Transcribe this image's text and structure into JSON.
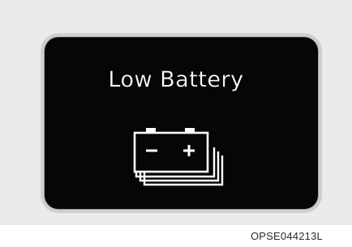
{
  "display": {
    "message": "Low Battery",
    "icon": "battery-warning-icon",
    "background_color": "#060606",
    "text_color": "#ffffff"
  },
  "caption": "OPSE044213L"
}
